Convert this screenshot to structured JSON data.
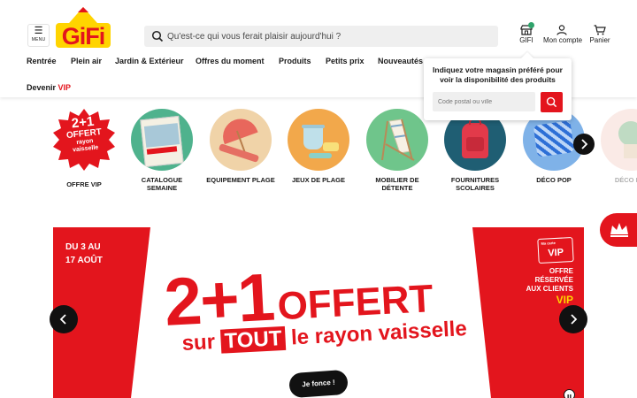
{
  "header": {
    "menu_label": "MENU",
    "logo_text": "GiFi",
    "search_placeholder": "Qu'est-ce qui vous ferait plaisir aujourd'hui ?",
    "store_label": "GIFI",
    "account_label": "Mon compte",
    "cart_label": "Panier"
  },
  "nav": {
    "items": [
      "Rentrée",
      "Plein air",
      "Jardin & Extérieur",
      "Offres du moment",
      "Produits",
      "Petits prix",
      "Nouveautés"
    ],
    "vip_prefix": "Devenir",
    "vip_word": "VIP"
  },
  "store_popup": {
    "text": "Indiquez votre magasin préféré pour voir la disponibilité des produits",
    "input_placeholder": "Code postal ou ville"
  },
  "categories": [
    {
      "label": "OFFRE VIP",
      "badge_line1": "2+1",
      "badge_line2": "OFFERT",
      "badge_line3": "rayon",
      "badge_line4": "vaisselle"
    },
    {
      "label": "CATALOGUE SEMAINE"
    },
    {
      "label": "EQUIPEMENT PLAGE"
    },
    {
      "label": "JEUX DE PLAGE"
    },
    {
      "label": "MOBILIER DE DÉTENTE"
    },
    {
      "label": "FOURNITURES SCOLAIRES"
    },
    {
      "label": "DÉCO POP"
    },
    {
      "label": "DÉCO ÉTÉ"
    }
  ],
  "banner": {
    "dates_line1": "DU 3 AU",
    "dates_line2": "17 AOÛT",
    "offer_big": "2+1",
    "offer_word": "OFFERT",
    "sub_prefix": "sur",
    "sub_tout": "TOUT",
    "sub_suffix": "le rayon vaisselle",
    "cta": "Je fonce !",
    "vip_card_small": "Ma carte",
    "vip_card": "VIP",
    "reserved_line1": "OFFRE",
    "reserved_line2": "RÉSERVÉE",
    "reserved_line3": "AUX CLIENTS",
    "reserved_vip": "VIP"
  },
  "colors": {
    "brand_red": "#e3151d",
    "brand_yellow": "#ffd400",
    "dark": "#111111"
  }
}
